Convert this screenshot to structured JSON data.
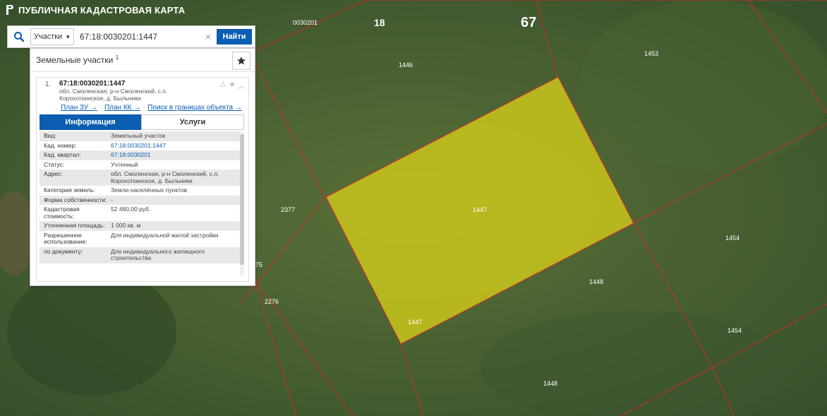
{
  "header": {
    "title": "ПУБЛИЧНАЯ КАДАСТРОВАЯ КАРТА"
  },
  "search": {
    "type": "Участки",
    "value": "67:18:0030201:1447",
    "find_label": "Найти"
  },
  "panel": {
    "title": "Земельные участки",
    "count": "1",
    "result": {
      "index": "1.",
      "cadastral_number": "67:18:0030201:1447",
      "address_line1": "обл. Смоленская, р-н Смоленский, с.п.",
      "address_line2": "Корохоткинское, д. Быльники",
      "links": [
        "План ЗУ →",
        "План КК →",
        "Поиск в границах объекта →"
      ]
    },
    "tabs": [
      "Информация",
      "Услуги"
    ],
    "info": [
      {
        "label": "Вид:",
        "value": "Земельный участок"
      },
      {
        "label": "Кад. номер:",
        "value": "67:18:0030201:1447"
      },
      {
        "label": "Кад. квартал:",
        "value": "67:18:0030201"
      },
      {
        "label": "Статус:",
        "value": "Учтенный"
      },
      {
        "label": "Адрес:",
        "value": "обл. Смоленская, р-н Смоленский, с.п. Корохоткинское, д. Быльники"
      },
      {
        "label": "Категория земель:",
        "value": "Земли населённых пунктов"
      },
      {
        "label": "Форма собственности:",
        "value": "-"
      },
      {
        "label": "Кадастровая стоимость:",
        "value": "52 460,00 руб."
      },
      {
        "label": "Уточненная площадь:",
        "value": "1 000 кв. м"
      },
      {
        "label": "Разрешенное использование:",
        "value": "Для индивидуальной жилой застройки"
      },
      {
        "label": "по документу:",
        "value": "Для индивидуального жилищного строительства"
      }
    ]
  },
  "map": {
    "labels": {
      "quarter": "0030201",
      "area_18": "18",
      "area_67": "67",
      "p1446": "1446",
      "p1453": "1453",
      "p2377": "2377",
      "p1447_center": "1447",
      "p1447_corner": "1447",
      "p1454_a": "1454",
      "p1454_b": "1454",
      "p1448_a": "1448",
      "p1448_b": "1448",
      "p2276": "2276",
      "p75": "75"
    },
    "colors": {
      "parcel_fill": "#c9c61c",
      "border": "#d12b2b",
      "bg": "#3f5a2a"
    }
  }
}
